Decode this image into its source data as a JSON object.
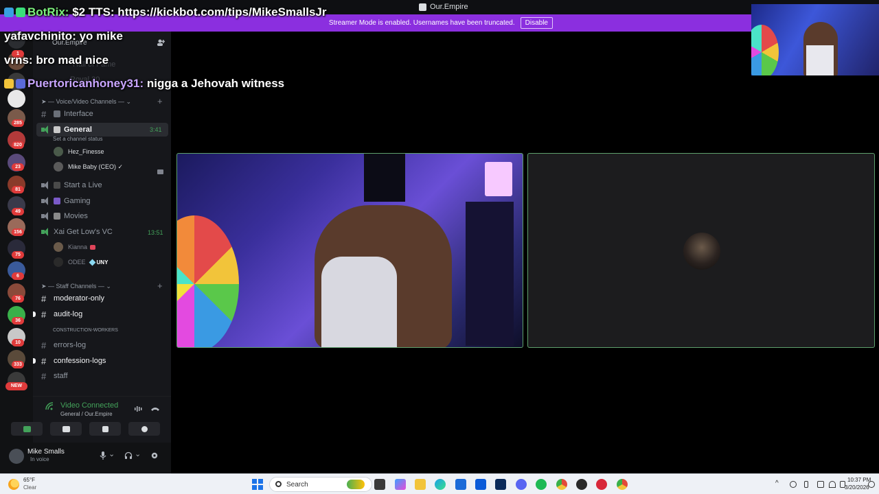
{
  "window": {
    "title": "Our.Empire"
  },
  "banner": {
    "text": "Streamer Mode is enabled. Usernames have been truncated.",
    "disable_label": "Disable"
  },
  "server_list": {
    "badges": [
      "1",
      "285",
      "820",
      "23",
      "81",
      "49",
      "156",
      "75",
      "6",
      "76",
      "36",
      "10",
      "333"
    ],
    "new_label": "NEW"
  },
  "channels": {
    "server_name": "Our.Empire",
    "faded_items": [
      "Hall of Fame",
      "Royal 30"
    ],
    "voice_category": "Voice/Video Channels",
    "interface": "Interface",
    "general": "General",
    "general_timer": "3:41",
    "general_status": "Set a channel status",
    "general_members": [
      "Hez_Finesse",
      "Mike Baby (CEO) ✓"
    ],
    "start_live": "Start a Live",
    "gaming": "Gaming",
    "movies": "Movies",
    "xai_vc": "Xai Get Low's VC",
    "xai_timer": "13:51",
    "xai_members": [
      "Kianna",
      "ODEE"
    ],
    "odee_tag": "UNY",
    "staff_category": "Staff Channels",
    "staff": [
      "moderator-only",
      "audit-log",
      "CONSTRUCTION-WORKERS",
      "errors-log",
      "confession-logs",
      "staff"
    ]
  },
  "voice_panel": {
    "title": "Video Connected",
    "subtitle": "General / Our.Empire"
  },
  "user_panel": {
    "name": "Mike Smalls",
    "status": "In voice"
  },
  "chat": {
    "lines": [
      {
        "nick": "BotRix:",
        "text": "$2 TTS: https://kickbot.com/tips/MikeSmallsJr"
      },
      {
        "nick": "yafavchinito:",
        "text": "yo mike"
      },
      {
        "nick": "vrns:",
        "text": "bro mad nice"
      },
      {
        "nick": "Puertoricanhoney31:",
        "text": "nigga a Jehovah witness"
      }
    ]
  },
  "taskbar": {
    "temp": "65°F",
    "condition": "Clear",
    "search_placeholder": "Search",
    "time": "10:37 PM",
    "date": "3/20/2026"
  },
  "colors": {
    "accent_green": "#43a25a",
    "banner_purple": "#8b2fdf",
    "badge_red": "#e03b3b"
  }
}
